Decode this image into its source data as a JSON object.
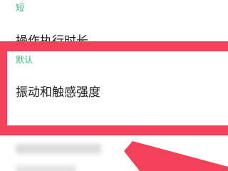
{
  "settings": {
    "short_value": "短",
    "operation_duration_title": "操作执行时长",
    "default_value": "默认",
    "vibration_title": "振动和触感强度"
  },
  "colors": {
    "accent_green": "#3bb97a",
    "highlight_red": "#f24158",
    "text_dark": "#202020"
  }
}
